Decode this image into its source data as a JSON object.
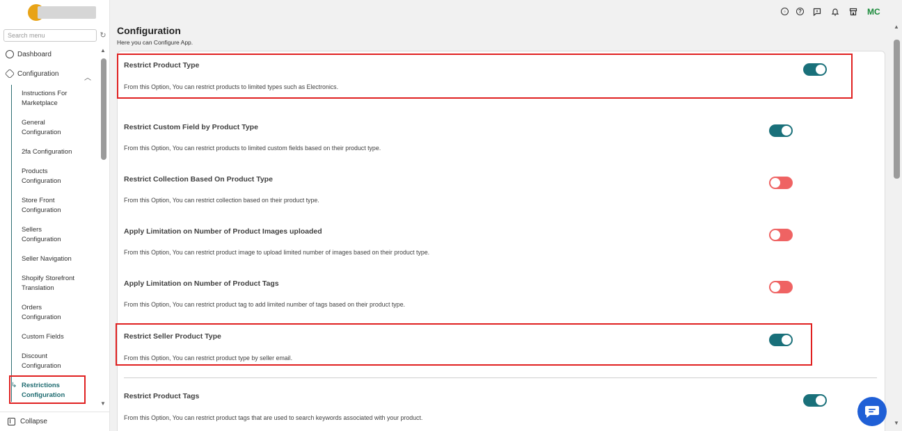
{
  "sidebar": {
    "search_placeholder": "Search menu",
    "dashboard_label": "Dashboard",
    "configuration_label": "Configuration",
    "sub_items": [
      [
        "Instructions For",
        "Marketplace"
      ],
      [
        "General",
        "Configuration"
      ],
      [
        "2fa Configuration"
      ],
      [
        "Products",
        "Configuration"
      ],
      [
        "Store Front",
        "Configuration"
      ],
      [
        "Sellers",
        "Configuration"
      ],
      [
        "Seller Navigation"
      ],
      [
        "Shopify Storefront",
        "Translation"
      ],
      [
        "Orders",
        "Configuration"
      ],
      [
        "Custom Fields"
      ],
      [
        "Discount",
        "Configuration"
      ],
      [
        "Restrictions",
        "Configuration"
      ]
    ],
    "active_index": 11,
    "collapse_label": "Collapse"
  },
  "topbar": {
    "user_initials": "MC",
    "icons": [
      "account-icon",
      "help-icon",
      "chat-message-icon",
      "bell-icon",
      "store-icon"
    ]
  },
  "header": {
    "title": "Configuration",
    "subtitle": "Here you can Configure App."
  },
  "options": [
    {
      "title": "Restrict Product Type",
      "desc": "From this Option, You can restrict products to limited types such as Electronics.",
      "enabled": true
    },
    {
      "title": "Restrict Custom Field by Product Type",
      "desc": "From this Option, You can restrict products to limited custom fields based on their product type.",
      "enabled": true
    },
    {
      "title": "Restrict Collection Based On Product Type",
      "desc": "From this Option, You can restrict collection based on their product type.",
      "enabled": false
    },
    {
      "title": "Apply Limitation on Number of Product Images uploaded",
      "desc": "From this Option, You can restrict product image to upload limited number of images based on their product type.",
      "enabled": false
    },
    {
      "title": "Apply Limitation on Number of Product Tags",
      "desc": "From this Option, You can restrict product tag to add limited number of tags based on their product type.",
      "enabled": false
    },
    {
      "title": "Restrict Seller Product Type",
      "desc": "From this Option, You can restrict product type by seller email.",
      "enabled": true
    },
    {
      "title": "Restrict Product Tags",
      "desc": "From this Option, You can restrict product tags that are used to search keywords associated with your product.",
      "enabled": true
    }
  ],
  "colors": {
    "toggle_on": "#19707a",
    "toggle_off": "#ef6363",
    "highlight": "#e02020",
    "accent": "#1e6b70",
    "chat_button": "#1f5fd6"
  }
}
